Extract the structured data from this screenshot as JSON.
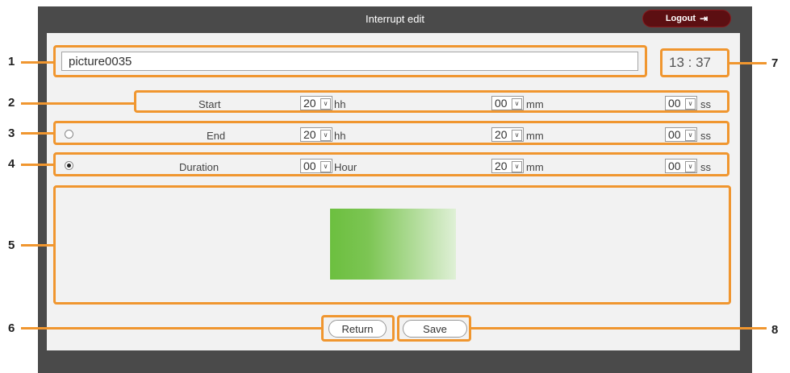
{
  "window": {
    "title": "Interrupt edit",
    "logout_label": "Logout",
    "logout_icon": "exit-icon"
  },
  "program": {
    "name": "picture0035",
    "clock": "13 : 37"
  },
  "start": {
    "label": "Start",
    "hh": "20",
    "hh_unit": "hh",
    "mm": "00",
    "mm_unit": "mm",
    "ss": "00",
    "ss_unit": "ss"
  },
  "end": {
    "label": "End",
    "selected": false,
    "hh": "20",
    "hh_unit": "hh",
    "mm": "20",
    "mm_unit": "mm",
    "ss": "00",
    "ss_unit": "ss"
  },
  "duration": {
    "label": "Duration",
    "selected": true,
    "hour": "00",
    "hour_unit": "Hour",
    "mm": "20",
    "mm_unit": "mm",
    "ss": "00",
    "ss_unit": "ss"
  },
  "buttons": {
    "return": "Return",
    "save": "Save"
  },
  "callouts": {
    "c1": "1",
    "c2": "2",
    "c3": "3",
    "c4": "4",
    "c5": "5",
    "c6": "6",
    "c7": "7",
    "c8": "8"
  },
  "colors": {
    "highlight": "#f0962f",
    "frame": "#4a4a4a",
    "logout": "#5c0f12",
    "preview_green": "#6cbf3f"
  }
}
